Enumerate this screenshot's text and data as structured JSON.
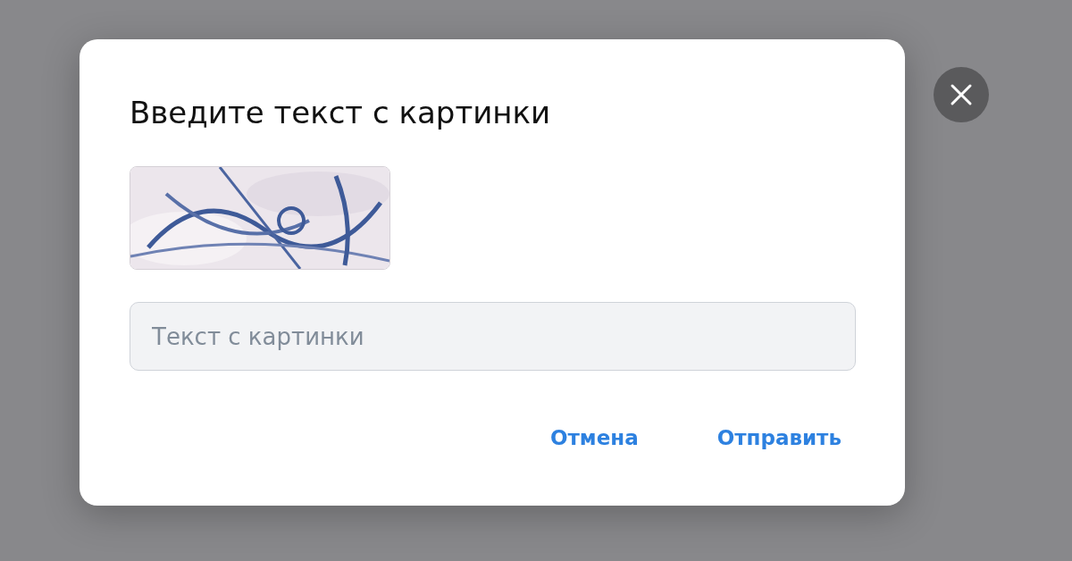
{
  "dialog": {
    "title": "Введите текст с картинки",
    "input": {
      "placeholder": "Текст с картинки"
    },
    "buttons": [
      {
        "label": "Отмена"
      },
      {
        "label": "Отправить"
      }
    ]
  }
}
